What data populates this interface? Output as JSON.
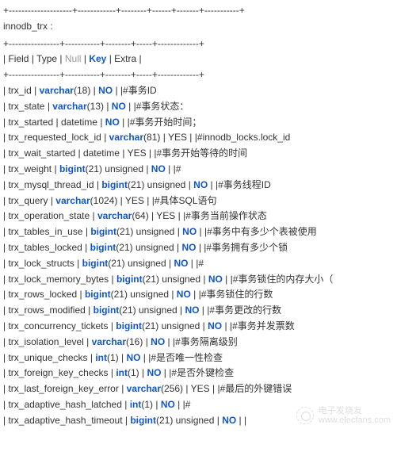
{
  "sep_top": "+--------------------+------------+--------+------+-------+-----------+",
  "title": "innodb_trx :",
  "sep_header": "+----------------+-----------+--------+-----+-------------+",
  "header": {
    "field": "Field",
    "type": "Type",
    "null": "Null",
    "key": "Key",
    "extra": "Extra"
  },
  "sep_body": "+----------------+-----------+--------+-----+-------------+",
  "rows": [
    {
      "field": "trx_id",
      "type_pre": "",
      "type_kw": "varchar",
      "type_args": "(18)",
      "type_post": "",
      "null_kw": "NO",
      "comment": "#事务ID"
    },
    {
      "field": "trx_state",
      "type_pre": "",
      "type_kw": "varchar",
      "type_args": "(13)",
      "type_post": "",
      "null_kw": "NO",
      "comment": "#事务状态："
    },
    {
      "field": "trx_started",
      "type_pre": "datetime",
      "type_kw": "",
      "type_args": "",
      "type_post": "",
      "null_kw": "NO",
      "comment": "#事务开始时间；"
    },
    {
      "field": "trx_requested_lock_id",
      "type_pre": "",
      "type_kw": "varchar",
      "type_args": "(81)",
      "type_post": "",
      "null_plain": "YES",
      "comment": "#innodb_locks.lock_id"
    },
    {
      "field": "trx_wait_started",
      "type_pre": "datetime",
      "type_kw": "",
      "type_args": "",
      "type_post": "",
      "null_plain": "YES",
      "comment": "#事务开始等待的时间"
    },
    {
      "field": "trx_weight",
      "type_pre": "",
      "type_kw": "bigint",
      "type_args": "(21) unsigned",
      "type_post": "",
      "null_kw": "NO",
      "comment": "#"
    },
    {
      "field": "trx_mysql_thread_id",
      "type_pre": "",
      "type_kw": "bigint",
      "type_args": "(21) unsigned",
      "type_post": "",
      "null_kw": "NO",
      "comment": "#事务线程ID"
    },
    {
      "field": "trx_query",
      "type_pre": "",
      "type_kw": "varchar",
      "type_args": "(1024)",
      "type_post": "",
      "null_plain": "YES",
      "comment": "#具体SQL语句"
    },
    {
      "field": "trx_operation_state",
      "type_pre": "",
      "type_kw": "varchar",
      "type_args": "(64)",
      "type_post": "",
      "null_plain": "YES",
      "comment": "#事务当前操作状态"
    },
    {
      "field": "trx_tables_in_use",
      "type_pre": "",
      "type_kw": "bigint",
      "type_args": "(21) unsigned",
      "type_post": "",
      "null_kw": "NO",
      "comment": "#事务中有多少个表被使用"
    },
    {
      "field": "trx_tables_locked",
      "type_pre": "",
      "type_kw": "bigint",
      "type_args": "(21) unsigned",
      "type_post": "",
      "null_kw": "NO",
      "comment": "#事务拥有多少个锁"
    },
    {
      "field": "trx_lock_structs",
      "type_pre": "",
      "type_kw": "bigint",
      "type_args": "(21) unsigned",
      "type_post": "",
      "null_kw": "NO",
      "comment": "#"
    },
    {
      "field": "trx_lock_memory_bytes",
      "type_pre": "",
      "type_kw": "bigint",
      "type_args": "(21) unsigned",
      "type_post": "",
      "null_kw": "NO",
      "comment": "#事务锁住的内存大小（"
    },
    {
      "field": "trx_rows_locked",
      "type_pre": "",
      "type_kw": "bigint",
      "type_args": "(21) unsigned",
      "type_post": "",
      "null_kw": "NO",
      "comment": "#事务锁住的行数"
    },
    {
      "field": "trx_rows_modified",
      "type_pre": "",
      "type_kw": "bigint",
      "type_args": "(21) unsigned",
      "type_post": "",
      "null_kw": "NO",
      "comment": "#事务更改的行数"
    },
    {
      "field": "trx_concurrency_tickets",
      "type_pre": "",
      "type_kw": "bigint",
      "type_args": "(21) unsigned",
      "type_post": "",
      "null_kw": "NO",
      "comment": "#事务并发票数"
    },
    {
      "field": "trx_isolation_level",
      "type_pre": "",
      "type_kw": "varchar",
      "type_args": "(16)",
      "type_post": "",
      "null_kw": "NO",
      "comment": "#事务隔离级别"
    },
    {
      "field": "trx_unique_checks",
      "type_pre": "",
      "type_kw": "int",
      "type_args": "(1)",
      "type_post": "",
      "null_kw": "NO",
      "comment": "#是否唯一性检查"
    },
    {
      "field": "trx_foreign_key_checks",
      "type_pre": "",
      "type_kw": "int",
      "type_args": "(1)",
      "type_post": "",
      "null_kw": "NO",
      "comment": "#是否外键检查"
    },
    {
      "field": "trx_last_foreign_key_error",
      "type_pre": "",
      "type_kw": "varchar",
      "type_args": "(256)",
      "type_post": "",
      "null_plain": "YES",
      "comment": "#最后的外键错误"
    },
    {
      "field": "trx_adaptive_hash_latched",
      "type_pre": "",
      "type_kw": "int",
      "type_args": "(1)",
      "type_post": "",
      "null_kw": "NO",
      "comment": "#"
    },
    {
      "field": "trx_adaptive_hash_timeout",
      "type_pre": "",
      "type_kw": "bigint",
      "type_args": "(21) unsigned",
      "type_post": "",
      "null_kw": "NO",
      "comment": ""
    }
  ],
  "watermark": {
    "line1": "电子发烧友",
    "line2": "www.elecfans.com"
  }
}
